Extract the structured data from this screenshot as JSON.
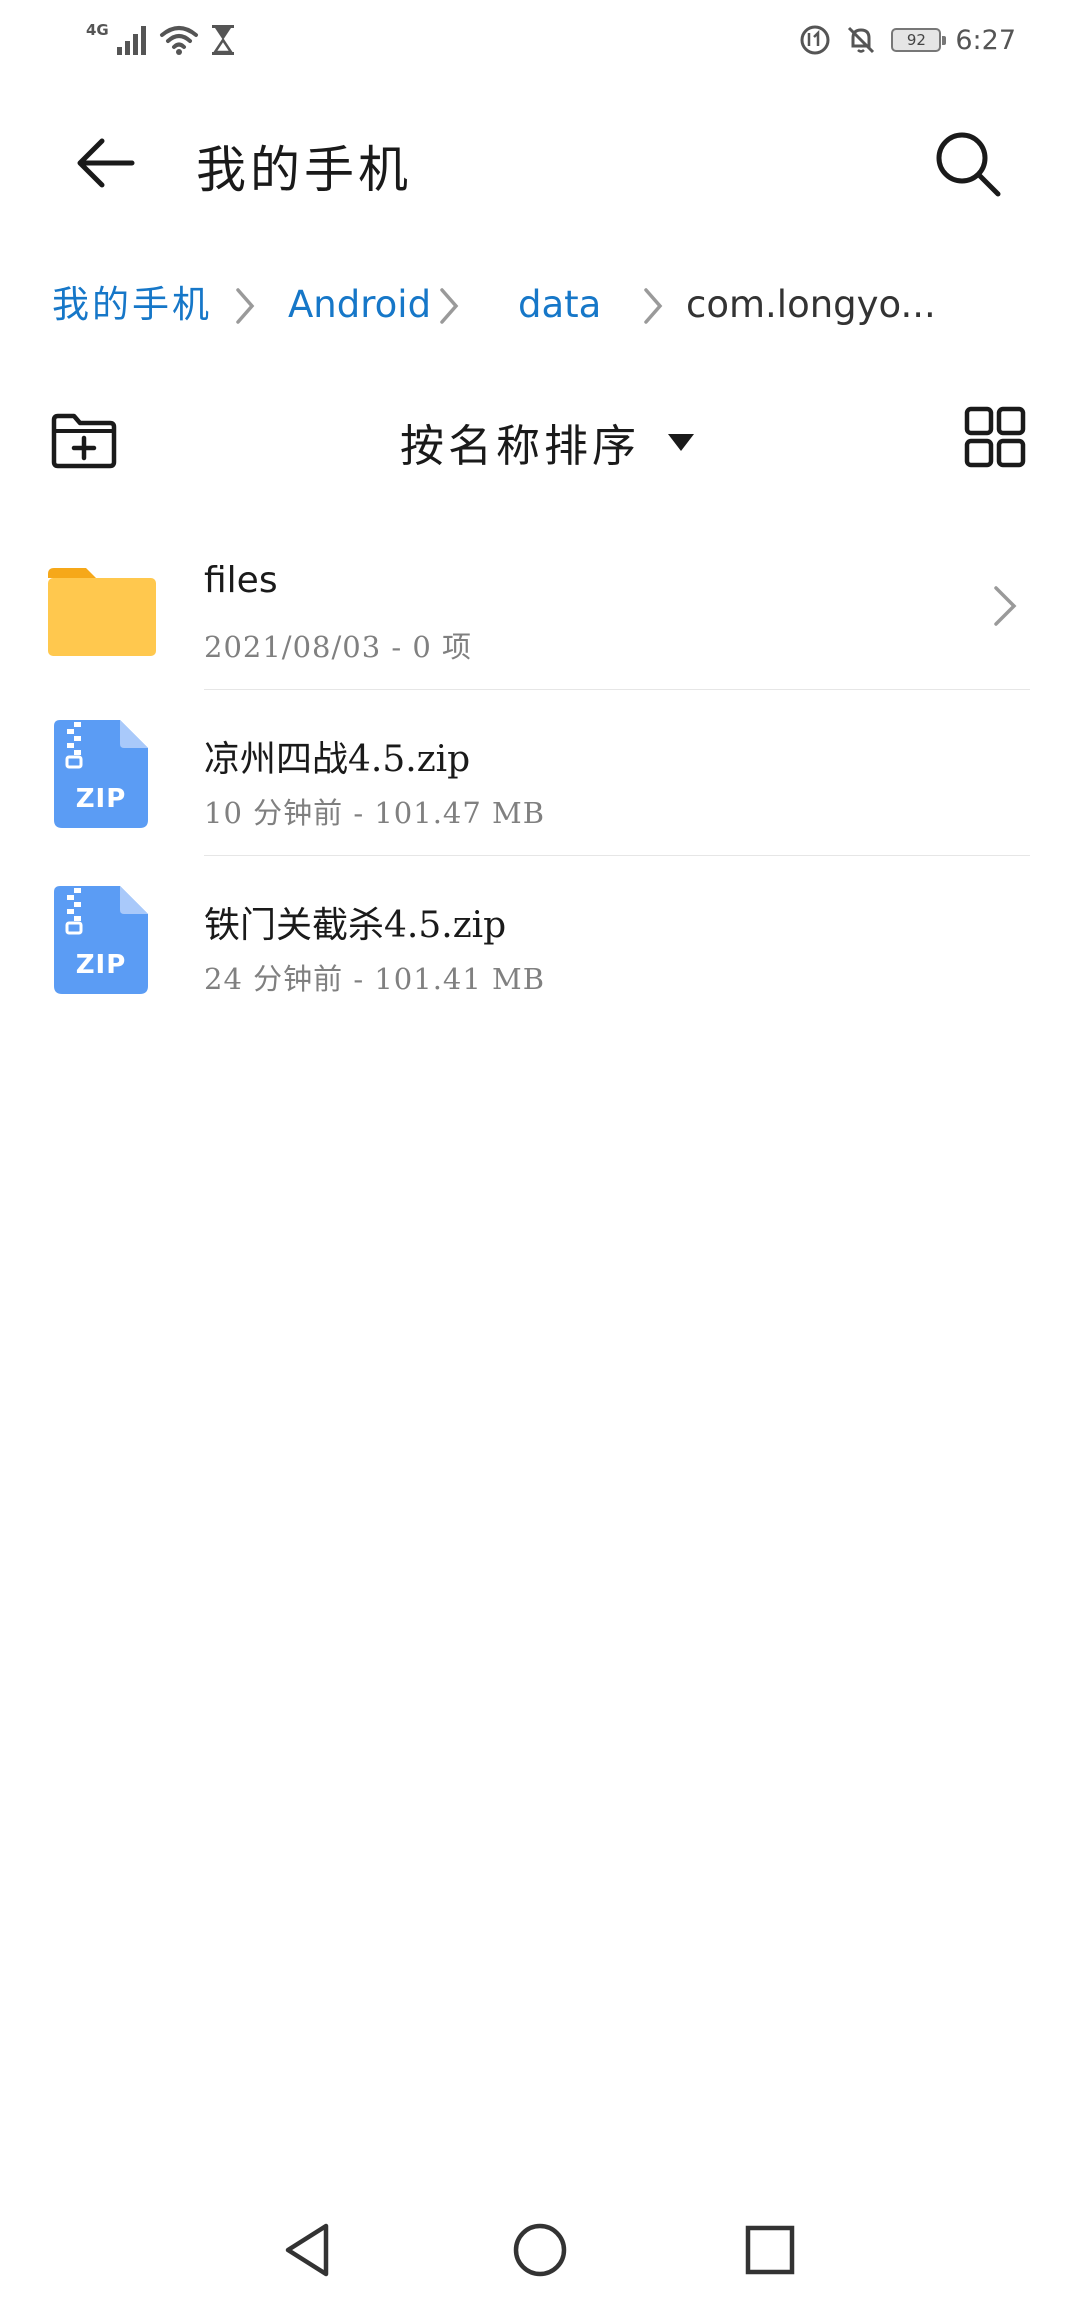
{
  "status_bar": {
    "network_type": "4G",
    "battery_level": "92",
    "time": "6:27"
  },
  "app_bar": {
    "title": "我的手机",
    "back_icon": "arrow-left-icon",
    "search_icon": "search-icon"
  },
  "breadcrumb": {
    "items": [
      {
        "label": "我的手机",
        "active": false
      },
      {
        "label": "Android",
        "active": false
      },
      {
        "label": "data",
        "active": false
      },
      {
        "label": "com.longyo...",
        "active": true
      }
    ]
  },
  "toolbar": {
    "sort_label": "按名称排序",
    "new_folder_icon": "folder-plus-icon",
    "view_toggle_icon": "grid-view-icon"
  },
  "files": [
    {
      "type": "folder",
      "name": "files",
      "meta": "2021/08/03 - 0 项",
      "icon": "folder-icon"
    },
    {
      "type": "zip",
      "name": "凉州四战4.5.zip",
      "meta": "10 分钟前 - 101.47 MB",
      "icon": "zip-file-icon",
      "icon_label": "ZIP"
    },
    {
      "type": "zip",
      "name": "铁门关截杀4.5.zip",
      "meta": "24 分钟前 - 101.41 MB",
      "icon": "zip-file-icon",
      "icon_label": "ZIP"
    }
  ],
  "colors": {
    "accent": "#1677c8",
    "folder": "#ffc84e",
    "folder_tab": "#f6a819",
    "zip": "#5b9cf4"
  }
}
